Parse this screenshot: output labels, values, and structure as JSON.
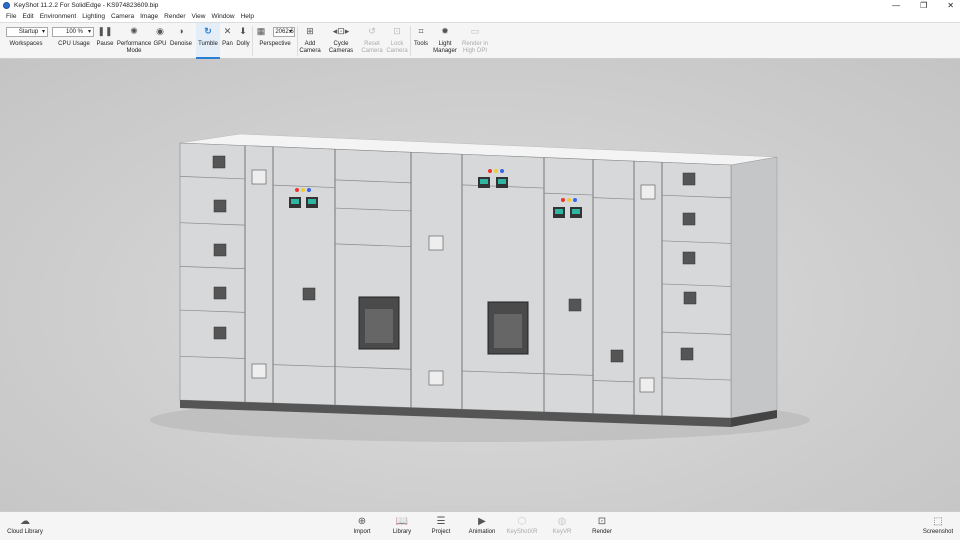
{
  "window": {
    "title": "KeyShot 11.2.2 For SolidEdge - KS974823609.bip",
    "minimize": "—",
    "restore": "❐",
    "close": "✕"
  },
  "menu": [
    "File",
    "Edit",
    "Environment",
    "Lighting",
    "Camera",
    "Image",
    "Render",
    "View",
    "Window",
    "Help"
  ],
  "toolbar": {
    "workspaces_value": "Startup",
    "workspaces_label": "Workspaces",
    "cpu_value": "100 %",
    "cpu_label": "CPU Usage",
    "pause": "Pause",
    "performance": "Performance Mode",
    "gpu": "GPU",
    "denoise": "Denoise",
    "tumble": "Tumble",
    "pan": "Pan",
    "dolly": "Dolly",
    "focal_value": "2062.6",
    "perspective": "Perspective",
    "add_camera": "Add Camera",
    "cycle_cameras": "Cycle Cameras",
    "reset_camera": "Reset Camera",
    "lock_camera": "Lock Camera",
    "tools": "Tools",
    "light_manager": "Light Manager",
    "render_high_dpi": "Render in High DPI"
  },
  "bottom": {
    "cloud_library": "Cloud Library",
    "import": "Import",
    "library": "Library",
    "project": "Project",
    "animation": "Animation",
    "keyshotxr": "KeyShotXR",
    "keyvr": "KeyVR",
    "render": "Render",
    "screenshot": "Screenshot"
  },
  "colors": {
    "accent": "#2a7fd4",
    "cabinet": "#d6d8da",
    "meter": "#2fb5a0"
  }
}
